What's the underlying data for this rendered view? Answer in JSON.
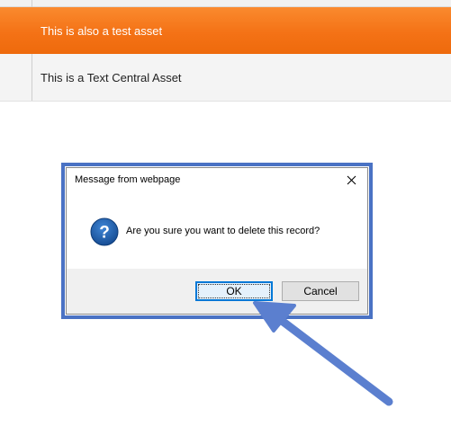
{
  "table": {
    "rows": [
      {
        "label": "This is also a test asset",
        "selected": true
      },
      {
        "label": "This is a Text Central Asset",
        "selected": false
      }
    ]
  },
  "dialog": {
    "title": "Message from webpage",
    "close_icon": "close-icon",
    "message_icon": "question-icon",
    "message": "Are you sure you want to delete this record?",
    "ok_label": "OK",
    "cancel_label": "Cancel"
  },
  "colors": {
    "selected_row": "#f47216",
    "highlight": "#4a72c4",
    "question_icon": "#1f5fae",
    "ok_button_border": "#0078d7"
  }
}
